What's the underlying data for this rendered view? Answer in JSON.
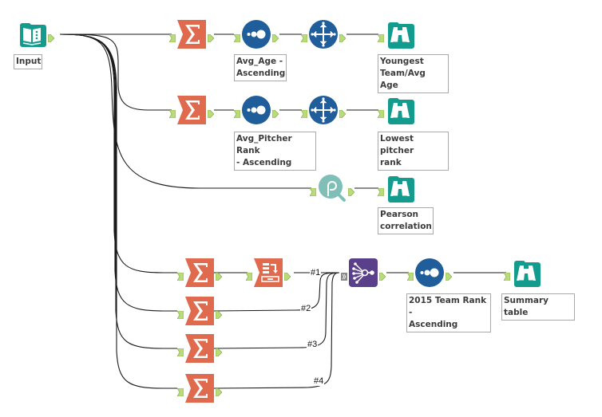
{
  "canvas": {
    "name": "workflow-canvas"
  },
  "colors": {
    "input": "#139b8d",
    "summarize": "#e06a4e",
    "sort": "#1f5d9b",
    "select": "#1f5d9b",
    "browse": "#139b8d",
    "pearson": "#7fbfb8",
    "union": "#5a3f8a",
    "anchor": "#b9dc7a",
    "connection": "#1a1a1a"
  },
  "tools": [
    {
      "id": "input",
      "type": "input-data",
      "icon": "book-icon",
      "label": "Input"
    },
    {
      "id": "sum1",
      "type": "summarize",
      "icon": "sigma-icon",
      "label": ""
    },
    {
      "id": "sort1",
      "type": "sort",
      "icon": "sort-dots-icon",
      "label": "Avg_Age -\nAscending"
    },
    {
      "id": "sel1",
      "type": "sample",
      "icon": "move-arrows-icon",
      "label": ""
    },
    {
      "id": "browse1",
      "type": "browse",
      "icon": "binoculars-icon",
      "label": "Youngest\nTeam/Avg Age"
    },
    {
      "id": "sum2",
      "type": "summarize",
      "icon": "sigma-icon",
      "label": ""
    },
    {
      "id": "sort2",
      "type": "sort",
      "icon": "sort-dots-icon",
      "label": "Avg_Pitcher Rank\n- Ascending"
    },
    {
      "id": "sel2",
      "type": "sample",
      "icon": "move-arrows-icon",
      "label": ""
    },
    {
      "id": "browse2",
      "type": "browse",
      "icon": "binoculars-icon",
      "label": "Lowest pitcher\nrank"
    },
    {
      "id": "pearson",
      "type": "pearson-correlation",
      "icon": "rho-magnifier-icon",
      "label": ""
    },
    {
      "id": "browse3",
      "type": "browse",
      "icon": "binoculars-icon",
      "label": "Pearson\ncorrelation"
    },
    {
      "id": "sum3",
      "type": "summarize",
      "icon": "sigma-icon",
      "label": ""
    },
    {
      "id": "transpose",
      "type": "cross-tab",
      "icon": "table-transpose-icon",
      "label": ""
    },
    {
      "id": "sum4",
      "type": "summarize",
      "icon": "sigma-icon",
      "label": ""
    },
    {
      "id": "sum5",
      "type": "summarize",
      "icon": "sigma-icon",
      "label": ""
    },
    {
      "id": "sum6",
      "type": "summarize",
      "icon": "sigma-icon",
      "label": ""
    },
    {
      "id": "union",
      "type": "union",
      "icon": "union-network-icon",
      "label": ""
    },
    {
      "id": "sort3",
      "type": "sort",
      "icon": "sort-dots-icon",
      "label": "2015 Team Rank -\nAscending"
    },
    {
      "id": "browse4",
      "type": "browse",
      "icon": "binoculars-icon",
      "label": "Summary table"
    }
  ],
  "connection_labels": [
    "#1",
    "#2",
    "#3",
    "#4"
  ]
}
